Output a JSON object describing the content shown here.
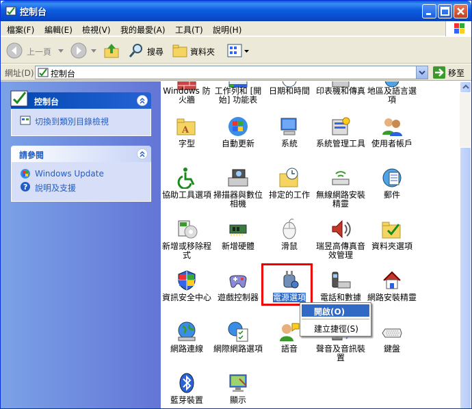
{
  "window": {
    "title": "控制台"
  },
  "menubar": {
    "items": [
      "檔案(F)",
      "編輯(E)",
      "檢視(V)",
      "我的最愛(A)",
      "工具(T)",
      "說明(H)"
    ]
  },
  "toolbar": {
    "back": "上一頁",
    "search": "搜尋",
    "folders": "資料夾"
  },
  "address": {
    "label": "網址(D)",
    "value": "控制台",
    "go": "移至"
  },
  "leftpane": {
    "panel1": {
      "title": "控制台",
      "link": "切換到類別目錄檢視"
    },
    "panel2": {
      "title": "請參閱",
      "links": [
        "Windows Update",
        "說明及支援"
      ]
    }
  },
  "items": [
    "Windows 防火牆",
    "工作列和 [開始] 功能表",
    "日期和時間",
    "印表機和傳真",
    "地區及語言選項",
    "字型",
    "自動更新",
    "系統",
    "系統管理工具",
    "使用者帳戶",
    "協助工具選項",
    "掃描器與數位相機",
    "排定的工作",
    "無線網路安裝精靈",
    "郵件",
    "新增或移除程式",
    "新增硬體",
    "滑鼠",
    "瑞昱高傳真音效管理",
    "資料夾選項",
    "資訊安全中心",
    "遊戲控制器",
    "電源選項",
    "電話和數據",
    "網路安裝精靈",
    "網路連線",
    "網際網路選項",
    "語音",
    "聲音及音訊裝置",
    "鍵盤",
    "藍芽裝置",
    "顯示"
  ],
  "context_menu": {
    "open": "開啟(O)",
    "shortcut": "建立捷徑(S)"
  },
  "colors": {
    "title_blue": "#0a5bd6",
    "selection": "#316ac5",
    "highlight_box": "#e00000",
    "task_pane": "#6375d6"
  }
}
